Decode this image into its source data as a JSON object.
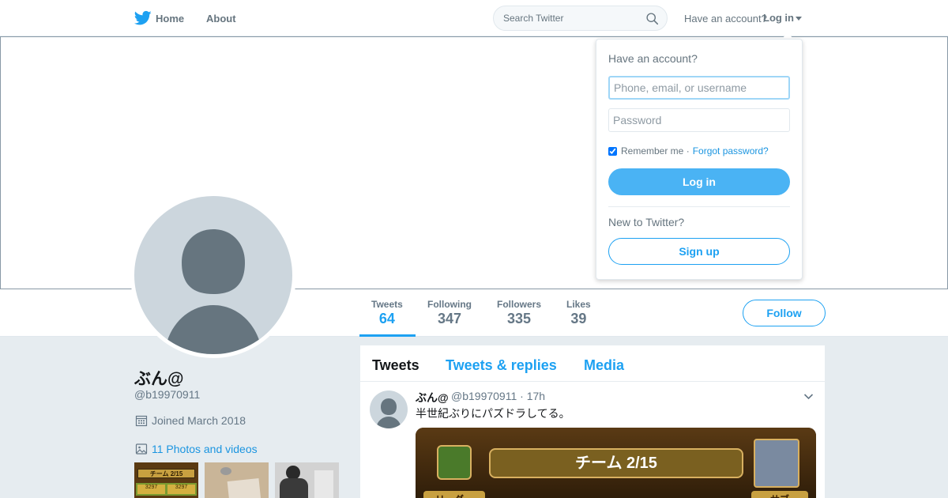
{
  "nav": {
    "home_label": "Home",
    "about_label": "About",
    "search_placeholder": "Search Twitter",
    "have_account": "Have an account?",
    "login_label": "Log in"
  },
  "profile": {
    "name": "ぶん@",
    "handle": "@b19970911",
    "joined": "Joined March 2018",
    "photos_label": "11 Photos and videos"
  },
  "stats": [
    {
      "label": "Tweets",
      "value": "64",
      "active": true
    },
    {
      "label": "Following",
      "value": "347",
      "active": false
    },
    {
      "label": "Followers",
      "value": "335",
      "active": false
    },
    {
      "label": "Likes",
      "value": "39",
      "active": false
    }
  ],
  "follow_label": "Follow",
  "timeline": {
    "tabs": [
      "Tweets",
      "Tweets & replies",
      "Media"
    ],
    "tweet": {
      "name": "ぶん@",
      "meta": "@b19970911 · 17h",
      "text": "半世紀ぶりにパズドラしてる。",
      "media_text": "チーム 2/15",
      "media_left_label": "リーダー",
      "media_right_label": "サブ"
    }
  },
  "thumbs": {
    "first_text": "チーム 2/15",
    "first_values": "3297"
  },
  "login_dropdown": {
    "title": "Have an account?",
    "username_placeholder": "Phone, email, or username",
    "password_placeholder": "Password",
    "remember_label": "Remember me ·",
    "forgot_label": "Forgot password?",
    "login_button": "Log in",
    "new_label": "New to Twitter?",
    "signup_button": "Sign up"
  },
  "colors": {
    "accent": "#1da1f2",
    "background": "#e6ecf0",
    "avatar_placeholder": "#ccd6dd",
    "avatar_silhouette": "#66757f"
  },
  "icons": {
    "logo": "twitter-bird-icon",
    "search": "magnifier-icon",
    "calendar": "calendar-icon",
    "photos": "image-icon",
    "tweet_menu": "chevron-down-icon"
  }
}
